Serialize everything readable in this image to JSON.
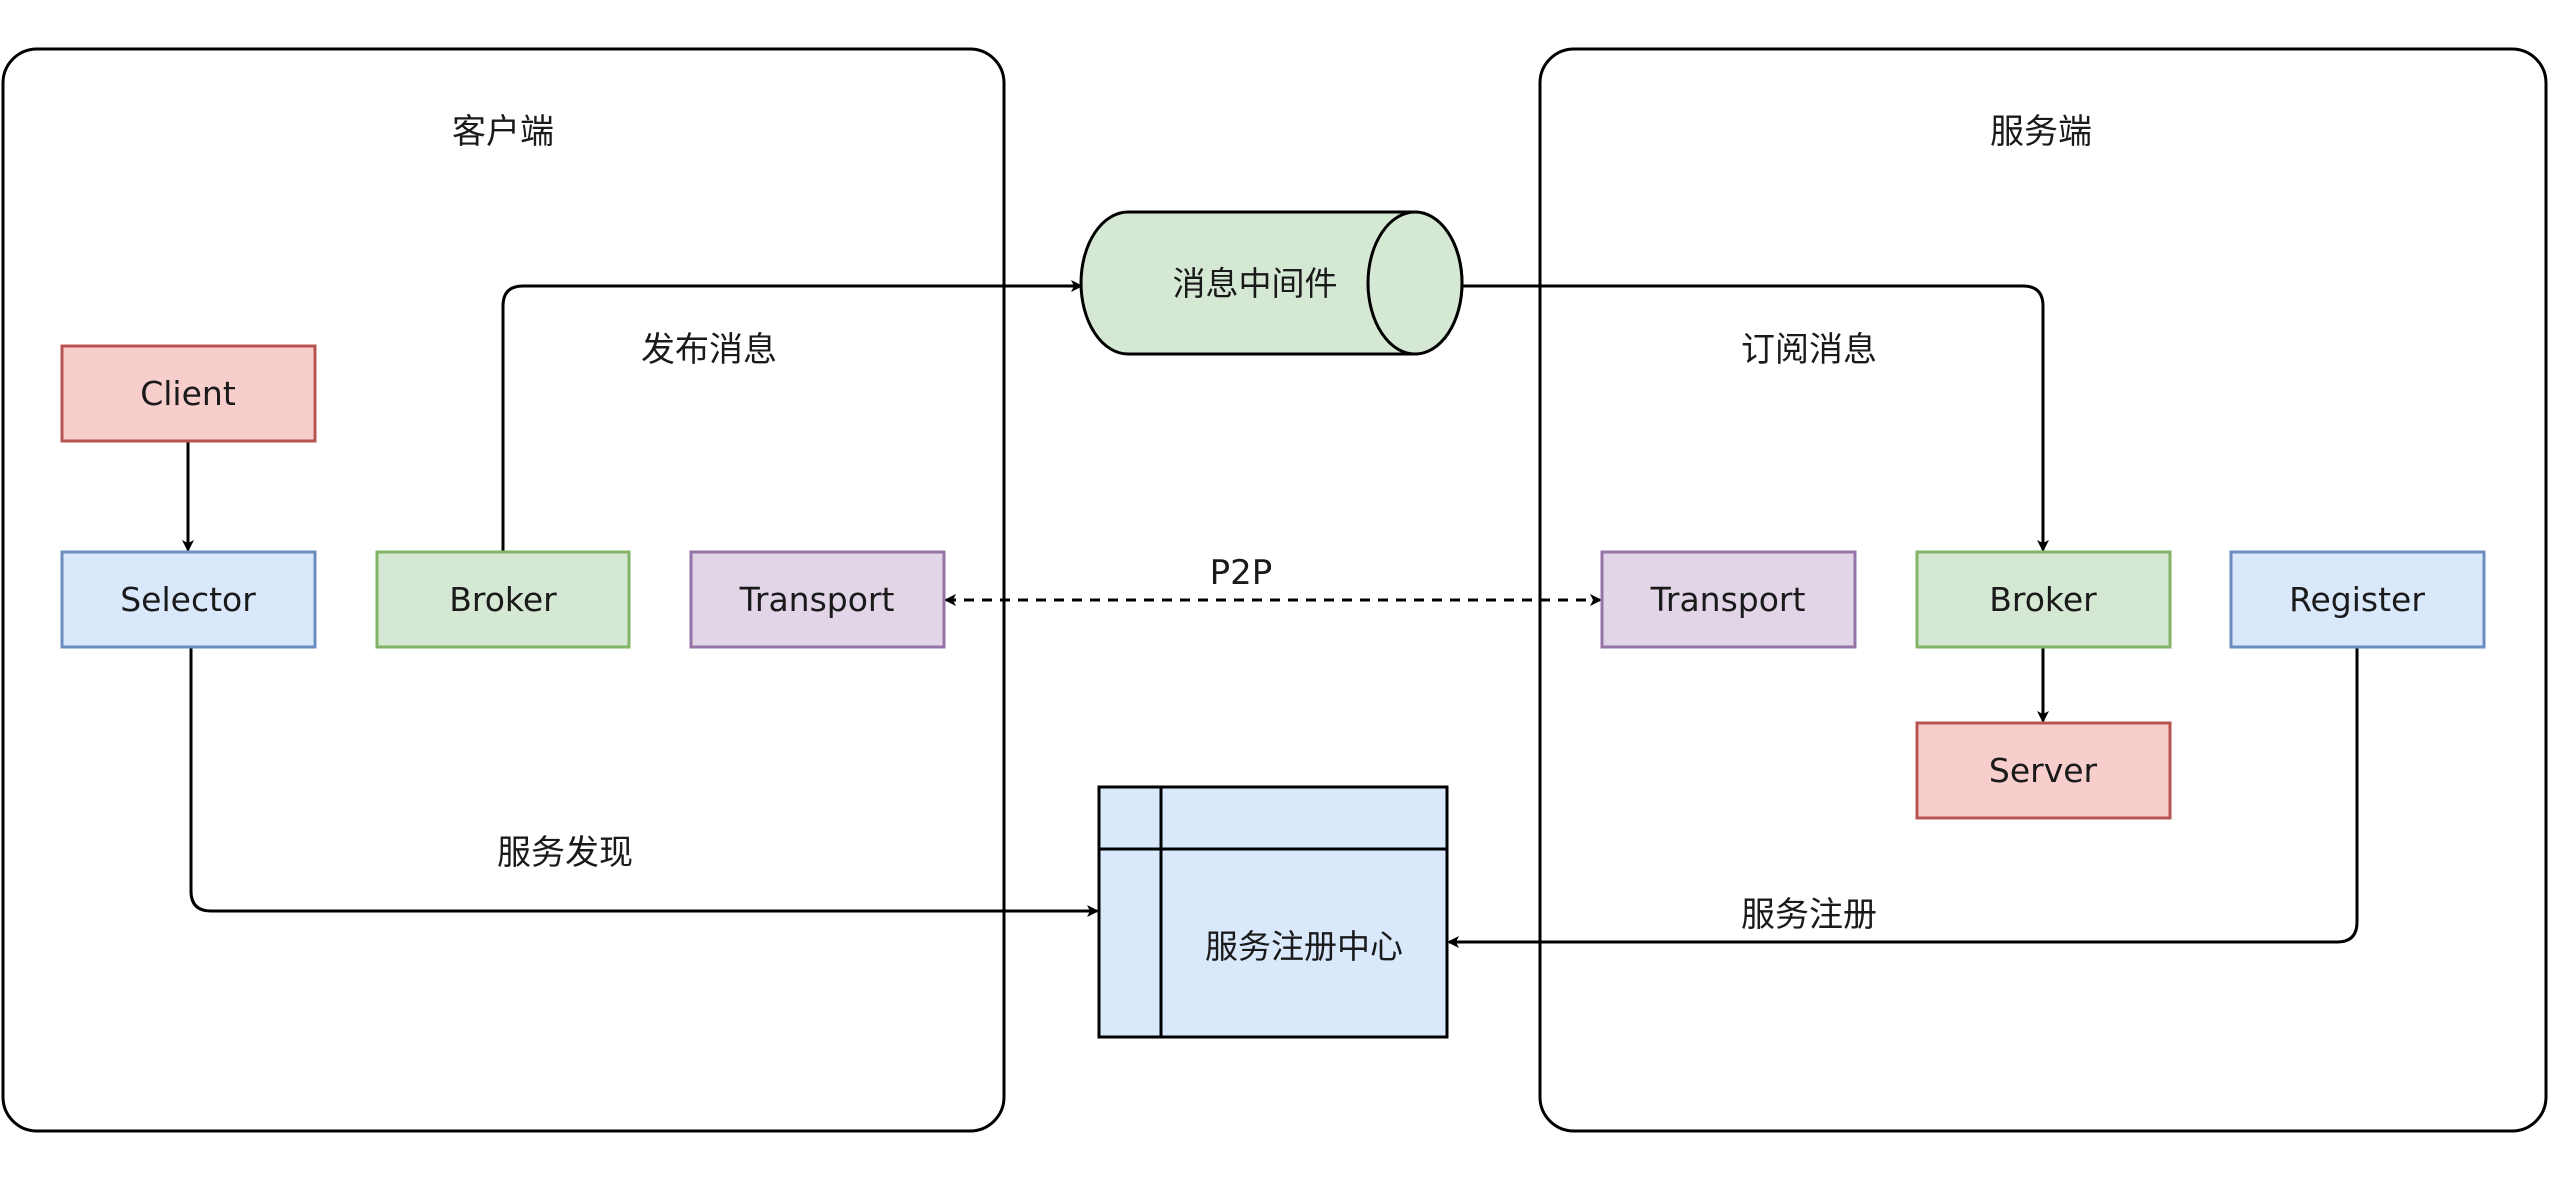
{
  "client_side": {
    "title": "客户端",
    "client": "Client",
    "selector": "Selector",
    "broker": "Broker",
    "transport": "Transport"
  },
  "server_side": {
    "title": "服务端",
    "transport": "Transport",
    "broker": "Broker",
    "register": "Register",
    "server": "Server"
  },
  "middleware": "消息中间件",
  "registry": "服务注册中心",
  "edges": {
    "publish": "发布消息",
    "subscribe": "订阅消息",
    "p2p": "P2P",
    "discovery": "服务发现",
    "registration": "服务注册"
  },
  "colors": {
    "red_fill": "#f8cecc",
    "red_stroke": "#b85450",
    "blue_fill": "#dae8fc",
    "blue_stroke": "#6c8ebf",
    "green_fill": "#d5e8d4",
    "green_stroke": "#82b366",
    "purple_fill": "#e1d5e7",
    "purple_stroke": "#9673a6"
  }
}
